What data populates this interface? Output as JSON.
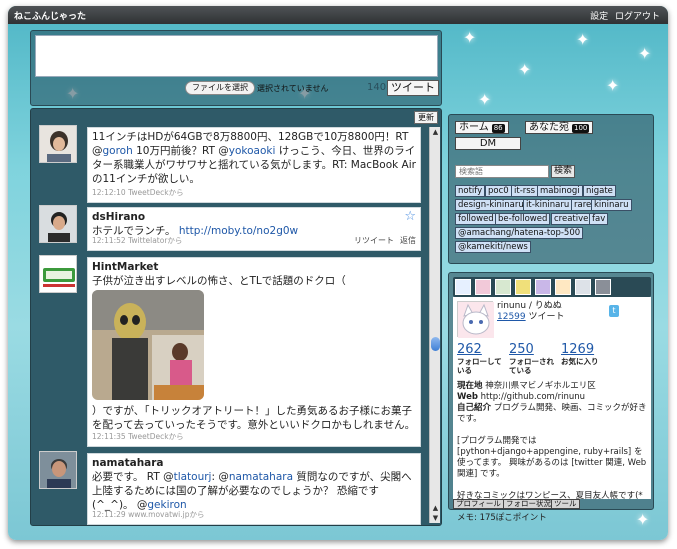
{
  "app": {
    "title": "ねこふんじゃった",
    "settings_label": "設定",
    "logout_label": "ログアウト"
  },
  "composer": {
    "placeholder": "",
    "file_button_label": "ファイルを選択",
    "file_status": "選択されていません",
    "char_count": "140",
    "tweet_button_label": "ツイート"
  },
  "timeline": {
    "refresh_label": "更新",
    "tweets": [
      {
        "user": "",
        "text_a": "11インチはHDが64GBで8万8800円、128GBで10万8800円！RT @",
        "mention_1": "goroh",
        "text_b": " 10万円前後？RT @",
        "mention_2": "yokoaoki",
        "text_c": " けっこう、今日、世界のライター系職業人がワサワサと揺れている気がします。RT: MacBook Air の11インチが欲しい。",
        "meta": "12:12:10 TweetDeckから"
      },
      {
        "user": "dsHirano",
        "text_a": "ホテルでランチ。 ",
        "link": "http://moby.to/no2g0w",
        "meta": "12:11:52 Twittelatorから",
        "retweet_label": "リツイート",
        "reply_label": "返信"
      },
      {
        "user": "HintMarket",
        "text_a": "子供が泣き出すレベルの怖さ、とTLで話題のドクロ（",
        "text_b": "）ですが、「トリックオアトリート！」した勇気あるお子様にお菓子を配って去っていったそうです。意外といいドクロかもしれません。",
        "meta": "12:11:35 TweetDeckから"
      },
      {
        "user": "namatahara",
        "text_a": "必要です。 RT @",
        "mention_1": "tlatourj",
        "text_b": ": @",
        "mention_2": "namatahara",
        "text_c": " 質問なのですが、尖閣へ上陸するためには国の了解が必要なのでしょうか？ 恐縮です(^_^)。 @",
        "mention_3": "gekiron",
        "meta": "12:11:29 www.movatwi.jpから"
      }
    ]
  },
  "nav": {
    "home_label": "ホーム",
    "home_count": "86",
    "mentions_label": "あなた宛",
    "mentions_count": "100",
    "dm_label": "DM",
    "search_placeholder": "検索語",
    "search_button_label": "検索",
    "tags": [
      "notify",
      "poc0",
      "it-rss",
      "mabinogi",
      "nigate",
      "design-kininaru",
      "it-kininaru",
      "rare",
      "kininaru",
      "followed",
      "be-followed",
      "creative",
      "fav",
      "@amachang/hatena-top-500",
      "@kamekiti/news"
    ]
  },
  "profile": {
    "name": "rinunu / りぬぬ",
    "tweet_count": "12599",
    "tweet_suffix": " ツイート",
    "following": "262",
    "following_label": "フォローしている",
    "followers": "250",
    "followers_label": "フォローされている",
    "favorites": "1269",
    "favorites_label": "お気に入り",
    "location_label": "現在地",
    "location": "神奈川県マビノギホルエリ区",
    "web_label": "Web",
    "web": "http://github.com/rinunu",
    "bio_label": "自己紹介",
    "bio_1": "プログラム開発、映画、コミックが好きです。",
    "bio_2": "[プログラム開発では [python+django+appengine, ruby+rails] を使ってます。 興味があるのは [twitter 関連, Web 関連] です。",
    "bio_3": "好きなコミックはワンピース、夏目友人帳です(*´ω`*)",
    "bio_4": "メモ: 175ぽこポイント",
    "tabs": [
      "プロフィール",
      "フォロー状況",
      "ツール"
    ]
  },
  "colors": {
    "accent_link": "#1f58a8",
    "tag_bg": "#cfe0f5",
    "panel_dark": "#2f5a68"
  }
}
